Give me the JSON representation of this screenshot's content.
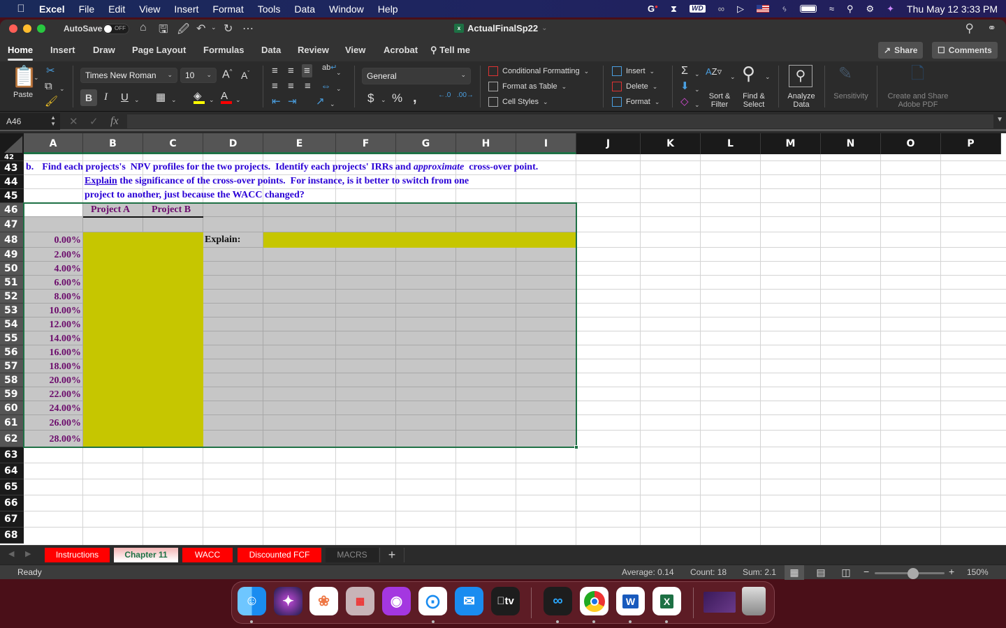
{
  "menubar": {
    "app_name": "Excel",
    "items": [
      "File",
      "Edit",
      "View",
      "Insert",
      "Format",
      "Tools",
      "Data",
      "Window",
      "Help"
    ],
    "status_icons": [
      "grammarly-icon",
      "creative-cloud-icon",
      "wd-icon",
      "webex-icon",
      "play-icon",
      "flag-us-icon",
      "bluetooth-icon",
      "battery-icon",
      "wifi-icon",
      "spotlight-icon",
      "control-center-icon",
      "siri-icon"
    ],
    "wd_label": "WD",
    "datetime": "Thu May 12  3:33 PM"
  },
  "titlebar": {
    "autosave_label": "AutoSave",
    "autosave_state": "OFF",
    "document_title": "ActualFinalSp22"
  },
  "ribbon_tabs": {
    "tabs": [
      "Home",
      "Insert",
      "Draw",
      "Page Layout",
      "Formulas",
      "Data",
      "Review",
      "View",
      "Acrobat"
    ],
    "active": "Home",
    "tell_me": "Tell me",
    "share_label": "Share",
    "comments_label": "Comments"
  },
  "ribbon": {
    "paste_label": "Paste",
    "font_name": "Times New Roman",
    "font_size": "10",
    "number_format": "General",
    "conditional_formatting": "Conditional Formatting",
    "format_as_table": "Format as Table",
    "cell_styles": "Cell Styles",
    "insert": "Insert",
    "delete": "Delete",
    "format": "Format",
    "sort_filter": "Sort &\nFilter",
    "sort_line1": "Sort &",
    "sort_line2": "Filter",
    "find_line1": "Find &",
    "find_line2": "Select",
    "analyze_line1": "Analyze",
    "analyze_line2": "Data",
    "sensitivity": "Sensitivity",
    "adobe_line1": "Create and Share",
    "adobe_line2": "Adobe PDF",
    "bold": "B",
    "italic": "I",
    "underline": "U",
    "fill_color": "#ffff00",
    "font_color": "#ff0000"
  },
  "formula_bar": {
    "name_box": "A46",
    "formula": "",
    "fx": "fx"
  },
  "grid": {
    "columns": [
      "A",
      "B",
      "C",
      "D",
      "E",
      "F",
      "G",
      "H",
      "I",
      "J",
      "K",
      "L",
      "M",
      "N",
      "O",
      "P"
    ],
    "selected_columns": [
      "A",
      "B",
      "C",
      "D",
      "E",
      "F",
      "G",
      "H",
      "I"
    ],
    "rows": [
      "42",
      "43",
      "44",
      "45",
      "46",
      "47",
      "48",
      "49",
      "50",
      "51",
      "52",
      "53",
      "54",
      "55",
      "56",
      "57",
      "58",
      "59",
      "60",
      "61",
      "62",
      "63",
      "64",
      "65",
      "66",
      "67",
      "68"
    ],
    "row43_b": "b.",
    "row43_text_1": "Find each projects's  NPV profiles for the two projects.  Identify each projects' IRRs and ",
    "row43_italic": "approximate",
    "row43_text_2": "  cross-over point.",
    "row44_link": "Explain",
    "row44_text": " the significance of the cross-over points.  For instance, is it better to switch from one",
    "row45_text": "project to another, just because the WACC changed?",
    "header_project_a": "Project A",
    "header_project_b": "Project B",
    "explain_label": "Explain:",
    "rates": [
      "0.00%",
      "2.00%",
      "4.00%",
      "6.00%",
      "8.00%",
      "10.00%",
      "12.00%",
      "14.00%",
      "16.00%",
      "18.00%",
      "20.00%",
      "22.00%",
      "24.00%",
      "26.00%",
      "28.00%"
    ],
    "colors": {
      "input_fill": "#c6c600",
      "block_fill": "#c6c6c6",
      "instruction_text": "#2a00d6",
      "rate_text": "#6b0a6b",
      "selection": "#1e7145"
    }
  },
  "sheet_tabs": {
    "tabs": [
      {
        "label": "Instructions",
        "style": "red"
      },
      {
        "label": "Chapter 11",
        "style": "active"
      },
      {
        "label": "WACC",
        "style": "red"
      },
      {
        "label": "Discounted FCF",
        "style": "red"
      },
      {
        "label": "MACRS",
        "style": "plain"
      }
    ],
    "add_label": "+"
  },
  "status_bar": {
    "status": "Ready",
    "average": "Average: 0.14",
    "count": "Count: 18",
    "sum": "Sum: 2.1",
    "zoom_level": "150%",
    "zoom_fraction": 0.55
  },
  "dock": {
    "apps": [
      "Finder",
      "Siri",
      "Photos",
      "Launchpad",
      "Podcasts",
      "Safari",
      "Mail",
      "Apple TV",
      "Webex",
      "Chrome",
      "Word",
      "Excel",
      "Recent Window",
      "Trash"
    ],
    "word_label": "W",
    "excel_label": "X",
    "tv_label": "tv"
  }
}
